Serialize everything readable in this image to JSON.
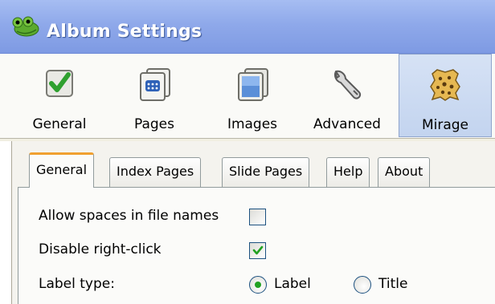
{
  "window": {
    "title": "Album Settings"
  },
  "toolbar": {
    "items": [
      {
        "label": "General",
        "icon": "checkmark-icon"
      },
      {
        "label": "Pages",
        "icon": "pages-grid-icon"
      },
      {
        "label": "Images",
        "icon": "images-icon"
      },
      {
        "label": "Advanced",
        "icon": "wrench-icon"
      },
      {
        "label": "Mirage",
        "icon": "mirage-leopard-icon",
        "active": true
      }
    ]
  },
  "tabs": [
    {
      "label": "General",
      "active": true
    },
    {
      "label": "Index Pages"
    },
    {
      "label": "Slide Pages"
    },
    {
      "label": "Help"
    },
    {
      "label": "About"
    }
  ],
  "settings": {
    "allow_spaces_label": "Allow spaces in file names",
    "allow_spaces_checked": false,
    "disable_right_click_label": "Disable right-click",
    "disable_right_click_checked": true,
    "label_type_label": "Label type:",
    "label_type_options": [
      "Label",
      "Title"
    ],
    "label_type_selected": "Label"
  },
  "colors": {
    "title_bar": "#8fa9ea",
    "active_tab_accent": "#f0a030",
    "check_green": "#21a121"
  }
}
